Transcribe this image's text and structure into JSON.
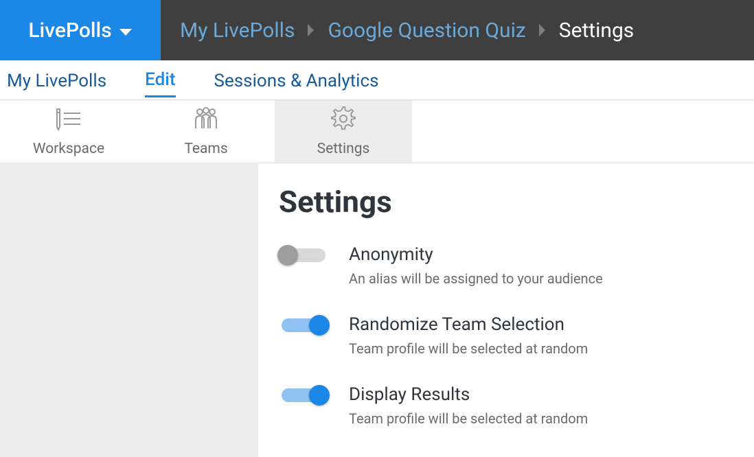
{
  "brand": {
    "label": "LivePolls"
  },
  "breadcrumb": {
    "items": [
      {
        "label": "My LivePolls",
        "current": false
      },
      {
        "label": "Google Question Quiz",
        "current": false
      },
      {
        "label": "Settings",
        "current": true
      }
    ]
  },
  "nav1": {
    "items": [
      {
        "label": "My LivePolls",
        "active": false
      },
      {
        "label": "Edit",
        "active": true
      },
      {
        "label": "Sessions & Analytics",
        "active": false
      }
    ]
  },
  "nav2": {
    "tabs": [
      {
        "label": "Workspace",
        "icon": "pencil-list-icon",
        "active": false
      },
      {
        "label": "Teams",
        "icon": "team-icon",
        "active": false
      },
      {
        "label": "Settings",
        "icon": "gear-icon",
        "active": true
      }
    ]
  },
  "main": {
    "heading": "Settings",
    "settings": [
      {
        "title": "Anonymity",
        "desc": "An alias will be assigned to your audience",
        "on": false
      },
      {
        "title": "Randomize Team Selection",
        "desc": "Team profile will be selected at random",
        "on": true
      },
      {
        "title": "Display Results",
        "desc": "Team profile will be selected at random",
        "on": true
      }
    ]
  }
}
